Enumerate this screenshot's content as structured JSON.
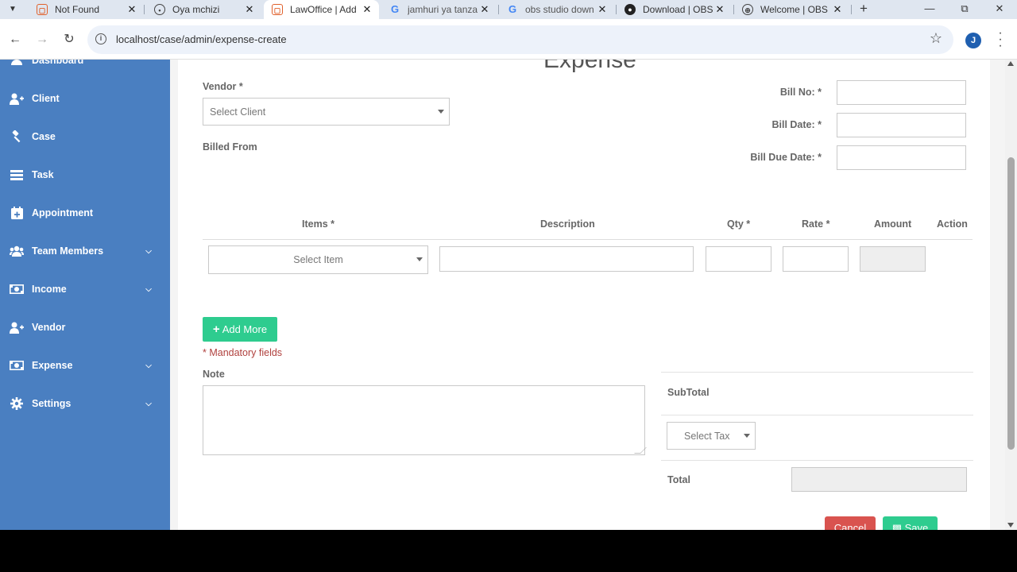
{
  "browser": {
    "tabs": [
      {
        "title": "Not Found",
        "favicon": "lawoffice-icon",
        "active": false
      },
      {
        "title": "Oya mchizi",
        "favicon": "gear-icon",
        "active": false
      },
      {
        "title": "LawOffice | Add",
        "favicon": "lawoffice-icon",
        "active": true
      },
      {
        "title": "jamhuri ya tanza",
        "favicon": "google-icon",
        "active": false
      },
      {
        "title": "obs studio down",
        "favicon": "google-icon",
        "active": false
      },
      {
        "title": "Download | OBS",
        "favicon": "obs-icon",
        "active": false
      },
      {
        "title": "Welcome | OBS",
        "favicon": "globe-icon",
        "active": false
      }
    ],
    "url": "localhost/case/admin/expense-create",
    "profile_initial": "J"
  },
  "sidebar": {
    "items": [
      {
        "label": "Dashboard",
        "icon": "dashboard-icon",
        "expandable": false
      },
      {
        "label": "Client",
        "icon": "user-plus-icon",
        "expandable": false
      },
      {
        "label": "Case",
        "icon": "gavel-icon",
        "expandable": false
      },
      {
        "label": "Task",
        "icon": "tasks-icon",
        "expandable": false
      },
      {
        "label": "Appointment",
        "icon": "calendar-plus-icon",
        "expandable": false
      },
      {
        "label": "Team Members",
        "icon": "users-icon",
        "expandable": true
      },
      {
        "label": "Income",
        "icon": "money-icon",
        "expandable": true
      },
      {
        "label": "Vendor",
        "icon": "user-plus-icon",
        "expandable": false
      },
      {
        "label": "Expense",
        "icon": "money-icon",
        "expandable": true
      },
      {
        "label": "Settings",
        "icon": "gear-icon",
        "expandable": true
      }
    ]
  },
  "form": {
    "title": "Expense",
    "vendor_label": "Vendor *",
    "vendor_placeholder": "Select Client",
    "billed_from_label": "Billed From",
    "bill_no_label": "Bill No: *",
    "bill_date_label": "Bill Date: *",
    "bill_due_date_label": "Bill Due Date: *",
    "bill_no_value": "",
    "bill_date_value": "",
    "bill_due_date_value": ""
  },
  "items_table": {
    "headers": {
      "items": "Items *",
      "description": "Description",
      "qty": "Qty *",
      "rate": "Rate *",
      "amount": "Amount",
      "action": "Action"
    },
    "row": {
      "item_placeholder": "Select Item",
      "description": "",
      "qty": "",
      "rate": "",
      "amount": ""
    }
  },
  "actions": {
    "add_more": "Add More",
    "mandatory_note": "* Mandatory fields",
    "cancel": "Cancel",
    "save": "Save"
  },
  "note": {
    "label": "Note",
    "value": ""
  },
  "summary": {
    "subtotal_label": "SubTotal",
    "tax_placeholder": "Select Tax",
    "total_label": "Total",
    "total_value": ""
  },
  "colors": {
    "sidebar_bg": "#4a7fc1",
    "add_button": "#2ecc8f",
    "cancel_button": "#d9534f",
    "mandatory_text": "#b0413e"
  }
}
